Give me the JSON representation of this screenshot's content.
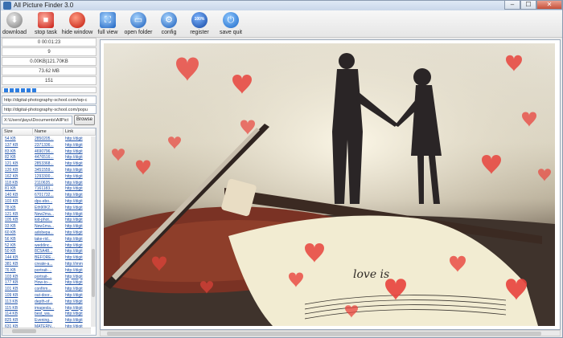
{
  "window": {
    "title": "All Picture Finder 3.0",
    "minimize": "‒",
    "maximize": "☐",
    "close": "✕"
  },
  "toolbar": [
    {
      "id": "download",
      "label": "download",
      "icon": "download-icon"
    },
    {
      "id": "stop",
      "label": "stop task",
      "icon": "stop-icon"
    },
    {
      "id": "hide",
      "label": "hide window",
      "icon": "hide-window-icon"
    },
    {
      "id": "full",
      "label": "full view",
      "icon": "fullscreen-icon"
    },
    {
      "id": "open",
      "label": "open folder",
      "icon": "folder-icon"
    },
    {
      "id": "config",
      "label": "config",
      "icon": "gear-icon"
    },
    {
      "id": "register",
      "label": "register",
      "icon": "badge-100-icon",
      "badge": "100%"
    },
    {
      "id": "save",
      "label": "save quit",
      "icon": "power-icon"
    }
  ],
  "stats": {
    "elapsed": "0 00:01:23",
    "count": "9",
    "transfer": "0.00KB|121.70KB",
    "total_size": "73.62 MB",
    "items": "151"
  },
  "progress": {
    "blocks": 6
  },
  "urls": {
    "url1": "http://digital-photography-school.com/wp-c",
    "url2": "http://digital-photography-school.com/popu",
    "save_path": "X:\\Users\\jiayu\\Documents\\AllPict",
    "browse_label": "Browse"
  },
  "list": {
    "columns": [
      "Size",
      "Name",
      "Link"
    ],
    "rows": [
      {
        "size": "54 KB",
        "name": "2850205...",
        "link": "http://digit"
      },
      {
        "size": "137 KB",
        "name": "2371336...",
        "link": "http://digit"
      },
      {
        "size": "83 KB",
        "name": "4690796...",
        "link": "http://digit"
      },
      {
        "size": "82 KB",
        "name": "4476516...",
        "link": "http://digit"
      },
      {
        "size": "121 KB",
        "name": "2853368...",
        "link": "http://digit"
      },
      {
        "size": "120 KB",
        "name": "3451559...",
        "link": "http://digit"
      },
      {
        "size": "162 KB",
        "name": "1293300...",
        "link": "http://digit"
      },
      {
        "size": "118 KB",
        "name": "2110635...",
        "link": "http://digit"
      },
      {
        "size": "81 KB",
        "name": "7161183...",
        "link": "http://digit"
      },
      {
        "size": "140 KB",
        "name": "6701732...",
        "link": "http://digit"
      },
      {
        "size": "103 KB",
        "name": "dps-ebo...",
        "link": "http://digit"
      },
      {
        "size": "78 KB",
        "name": "Eth90K2...",
        "link": "http://digit"
      },
      {
        "size": "121 KB",
        "name": "New2ma...",
        "link": "http://digit"
      },
      {
        "size": "105 KB",
        "name": "kid-phot...",
        "link": "http://digit"
      },
      {
        "size": "93 KB",
        "name": "New1ma...",
        "link": "http://digit"
      },
      {
        "size": "60 KB",
        "name": "adobepa...",
        "link": "http://digit"
      },
      {
        "size": "56 KB",
        "name": "take-rid...",
        "link": "http://digit"
      },
      {
        "size": "52 KB",
        "name": "weddinc...",
        "link": "http://digit"
      },
      {
        "size": "50 KB",
        "name": "8C5A48...",
        "link": "http://digit"
      },
      {
        "size": "144 KB",
        "name": "BEFORE...",
        "link": "http://digit"
      },
      {
        "size": "381 KB",
        "name": "create-a...",
        "link": "http://imm"
      },
      {
        "size": "76 KB",
        "name": "portrait-...",
        "link": "http://digit"
      },
      {
        "size": "103 KB",
        "name": "portrait-...",
        "link": "http://digit"
      },
      {
        "size": "177 KB",
        "name": "How-to-...",
        "link": "http://digit"
      },
      {
        "size": "101 KB",
        "name": "confirm...",
        "link": "http://digit"
      },
      {
        "size": "109 KB",
        "name": "out-door...",
        "link": "http://digit"
      },
      {
        "size": "113 KB",
        "name": "depth-of...",
        "link": "http://digit"
      },
      {
        "size": "115 KB",
        "name": "imagesla...",
        "link": "http://digit"
      },
      {
        "size": "114 KB",
        "name": "best_wa...",
        "link": "http://digit"
      },
      {
        "size": "825 KB",
        "name": "Evening...",
        "link": "http://digit"
      },
      {
        "size": "631 KB",
        "name": "MATERN...",
        "link": "http://digit"
      }
    ]
  },
  "preview": {
    "paper_text": "love is",
    "colors": {
      "heart": "#e8433c",
      "sky": "#dcd6c4",
      "violin": "#7a3224",
      "paper": "#f2ecd2"
    }
  }
}
